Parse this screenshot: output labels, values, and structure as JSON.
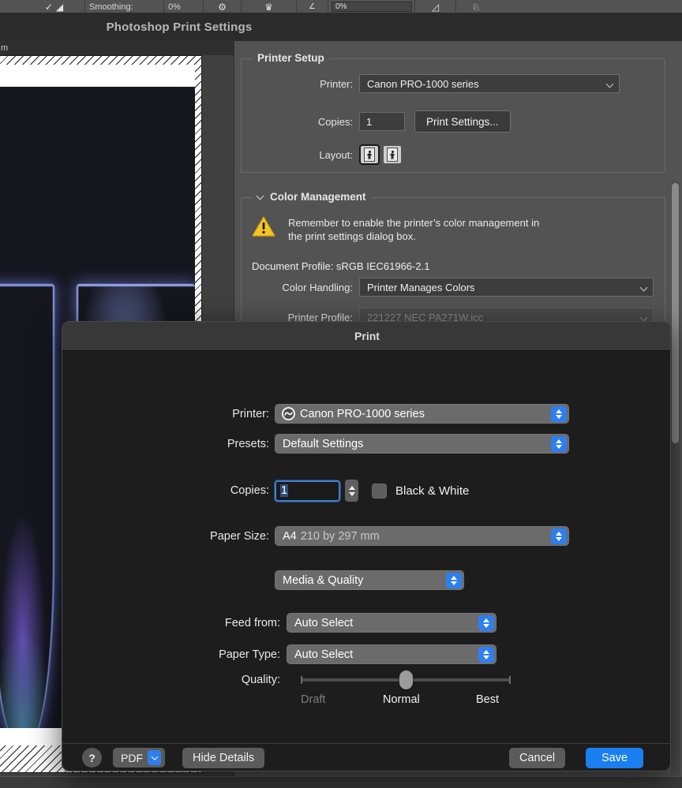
{
  "photoshop_toolbar": {
    "smoothing_label": "Smoothing:",
    "smoothing_value": "0%",
    "opacity_value": "0%",
    "brush_icon": "brush-icon",
    "airbrush_icon": "airbrush-icon",
    "settings_icon": "tablet-pressure-icon",
    "symmetry_icon": "symmetry-butterfly-icon",
    "angle_icon": "angle-icon",
    "smoothing_options_icon": "smoothing-options-icon"
  },
  "photoshop_window": {
    "title": "Photoshop Print Settings"
  },
  "preview": {
    "unit_label": "m"
  },
  "printer_setup": {
    "title": "Printer Setup",
    "printer_label": "Printer:",
    "printer_value": "Canon PRO-1000 series",
    "copies_label": "Copies:",
    "copies_value": "1",
    "print_settings_button": "Print Settings...",
    "layout_label": "Layout:",
    "layout_portrait_icon": "layout-portrait-icon",
    "layout_landscape_icon": "layout-landscape-icon"
  },
  "color_management": {
    "title": "Color Management",
    "warning_icon": "warning-triangle-icon",
    "warning_text": "Remember to enable the printer’s color management in the print settings dialog box.",
    "document_profile": "Document Profile: sRGB IEC61966-2.1",
    "color_handling_label": "Color Handling:",
    "color_handling_value": "Printer Manages Colors",
    "printer_profile_label": "Printer Profile:",
    "printer_profile_value": "221227 NEC PA271W.icc"
  },
  "print_sheet": {
    "title": "Print",
    "printer_label": "Printer:",
    "printer_value": "Canon PRO-1000 series",
    "printer_status_icon": "printer-status-icon",
    "presets_label": "Presets:",
    "presets_value": "Default Settings",
    "copies_label": "Copies:",
    "copies_value": "1",
    "black_white_label": "Black & White",
    "black_white_checked": false,
    "paper_size_label": "Paper Size:",
    "paper_size_value": "A4",
    "paper_size_dimensions": "210 by 297 mm",
    "pane_value": "Media & Quality",
    "feed_from_label": "Feed from:",
    "feed_from_value": "Auto Select",
    "paper_type_label": "Paper Type:",
    "paper_type_value": "Auto Select",
    "quality_label": "Quality:",
    "quality_ticks": [
      "Draft",
      "Normal",
      "Best"
    ],
    "quality_selected": "Normal",
    "quality_position_percent": 50,
    "footer": {
      "help_label": "?",
      "pdf_label": "PDF",
      "hide_details_label": "Hide Details",
      "cancel_label": "Cancel",
      "save_label": "Save"
    }
  },
  "colors": {
    "accent_blue": "#1a7ff0",
    "stepper_blue": "#2d7ff0",
    "warning_yellow": "#f5c518",
    "panel_gray": "#535353",
    "sheet_dark": "#1d1d1d"
  }
}
